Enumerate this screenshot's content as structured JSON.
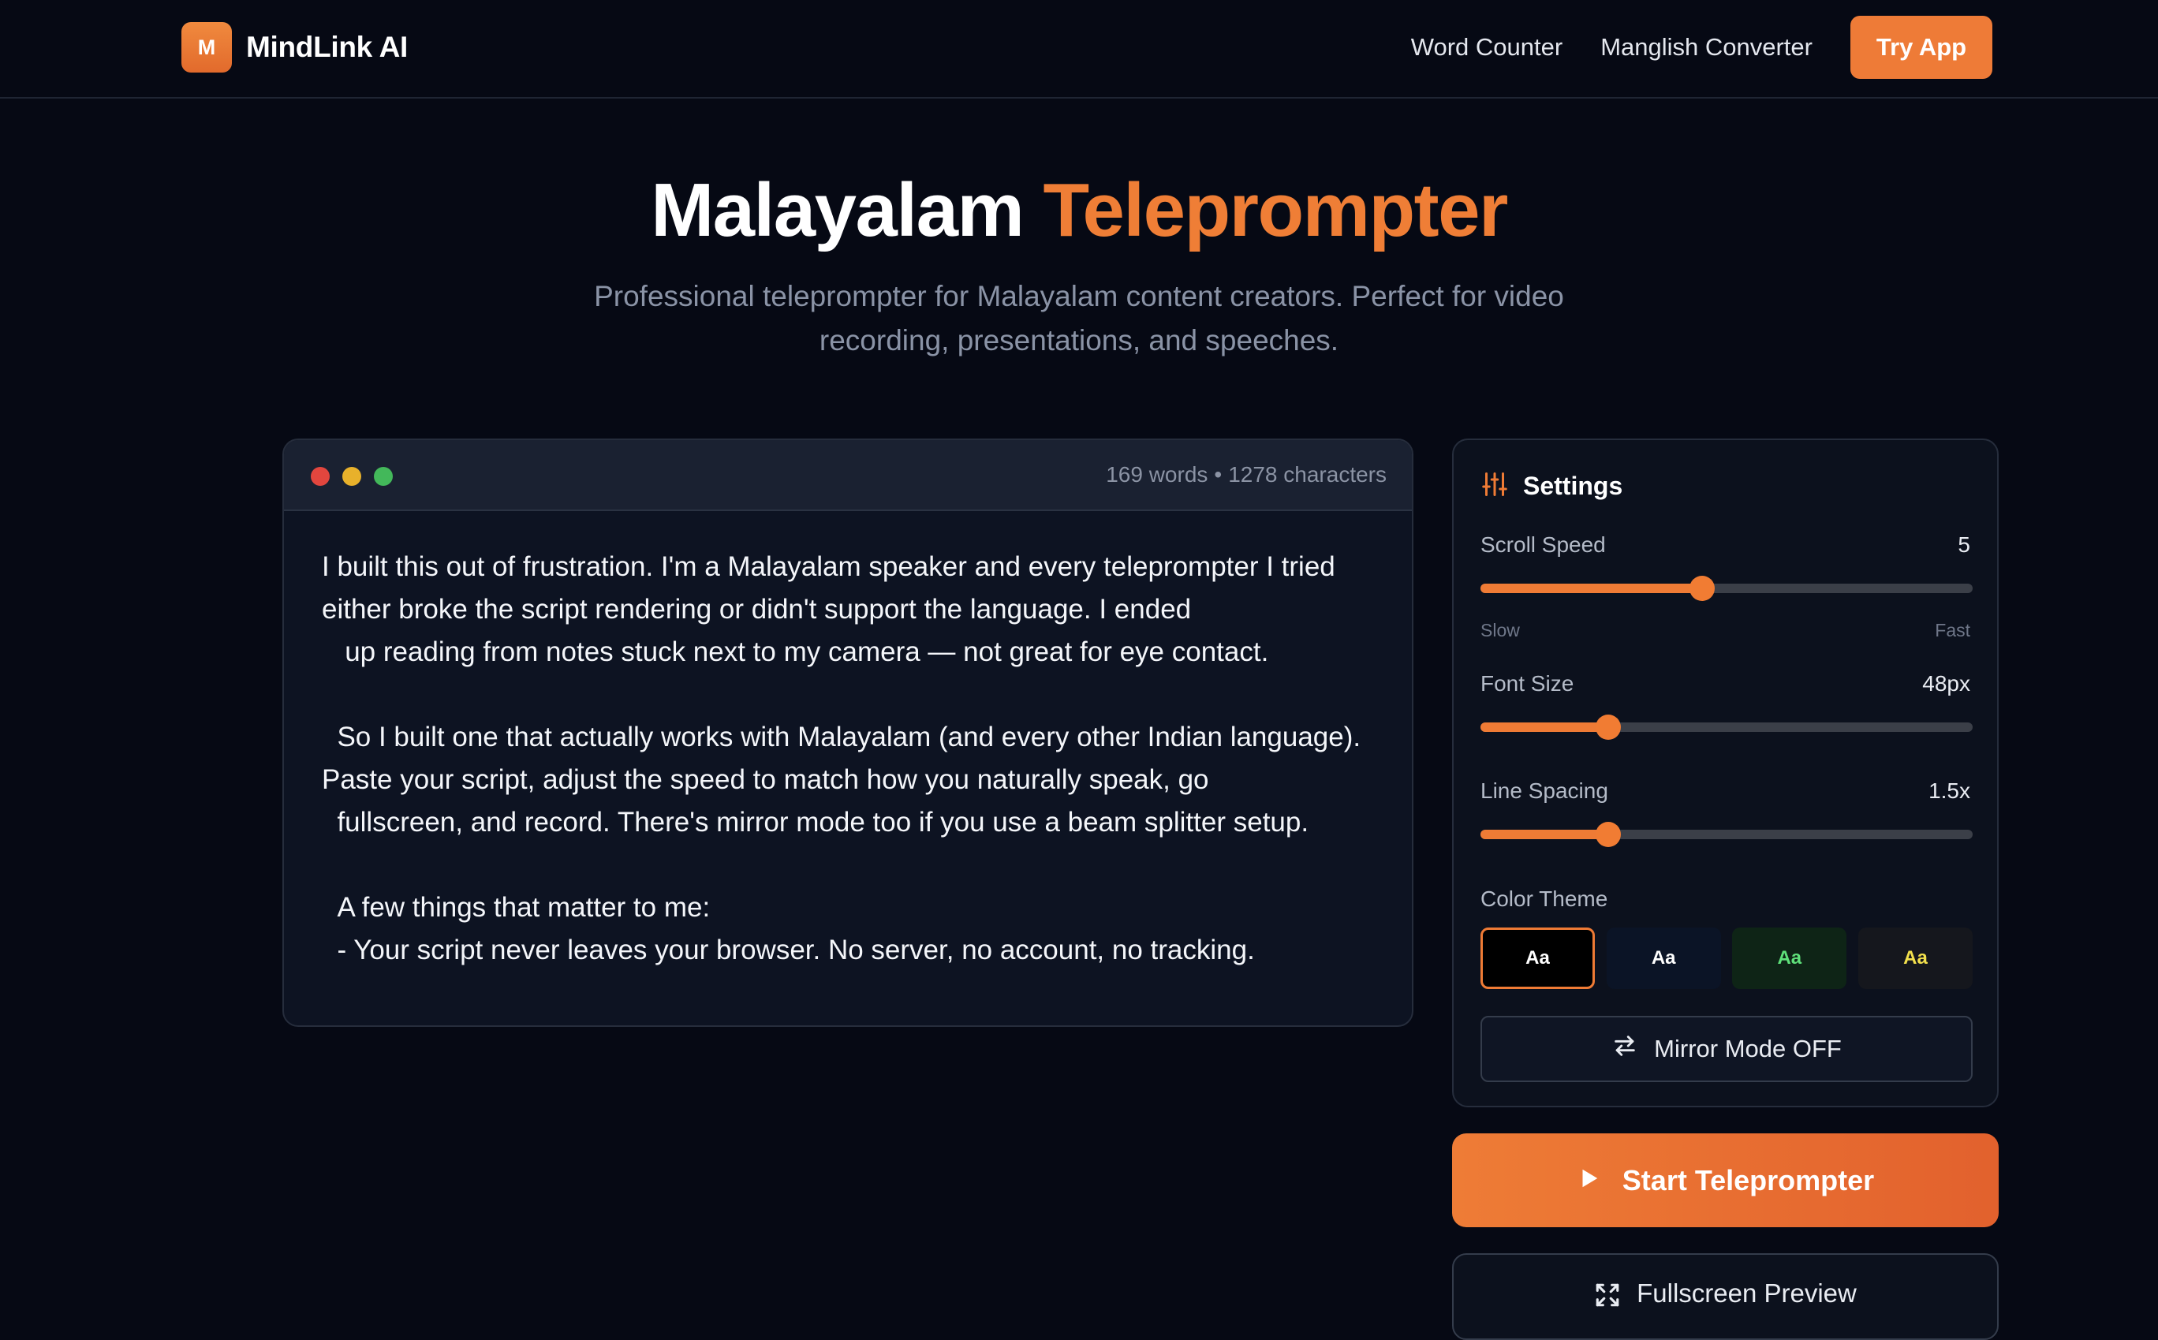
{
  "nav": {
    "logo_letter": "M",
    "brand": "MindLink AI",
    "links": [
      "Word Counter",
      "Manglish Converter"
    ],
    "cta": "Try App"
  },
  "hero": {
    "title_plain": "Malayalam",
    "title_accent": "Teleprompter",
    "subtitle": "Professional teleprompter for Malayalam content creators. Perfect for video recording, presentations, and speeches."
  },
  "editor": {
    "word_count": "169 words",
    "separator": "•",
    "char_count": "1278 characters",
    "script": "I built this out of frustration. I'm a Malayalam speaker and every teleprompter I tried either broke the script rendering or didn't support the language. I ended\n   up reading from notes stuck next to my camera — not great for eye contact.\n\n  So I built one that actually works with Malayalam (and every other Indian language). Paste your script, adjust the speed to match how you naturally speak, go\n  fullscreen, and record. There's mirror mode too if you use a beam splitter setup.\n\n  A few things that matter to me:\n  - Your script never leaves your browser. No server, no account, no tracking."
  },
  "settings": {
    "title": "Settings",
    "scroll_speed": {
      "label": "Scroll Speed",
      "value": "5",
      "level": 0.45,
      "min_hint": "Slow",
      "max_hint": "Fast"
    },
    "font_size": {
      "label": "Font Size",
      "value": "48px",
      "level": 0.26
    },
    "line_spacing": {
      "label": "Line Spacing",
      "value": "1.5x",
      "level": 0.26
    },
    "color_theme": {
      "label": "Color Theme",
      "options": [
        {
          "label": "Aa",
          "bg": "#000000",
          "fg": "#ffffff",
          "selected": true
        },
        {
          "label": "Aa",
          "bg": "#0b1426",
          "fg": "#ffffff",
          "selected": false
        },
        {
          "label": "Aa",
          "bg": "#0e2416",
          "fg": "#5fe07a",
          "selected": false
        },
        {
          "label": "Aa",
          "bg": "#15171d",
          "fg": "#f2e04d",
          "selected": false
        }
      ]
    },
    "mirror_button": "Mirror Mode OFF"
  },
  "actions": {
    "start": "Start Teleprompter",
    "fullscreen": "Fullscreen Preview"
  },
  "colors": {
    "accent": "#ef7b35",
    "background": "#060914",
    "panel": "#0c111d"
  }
}
